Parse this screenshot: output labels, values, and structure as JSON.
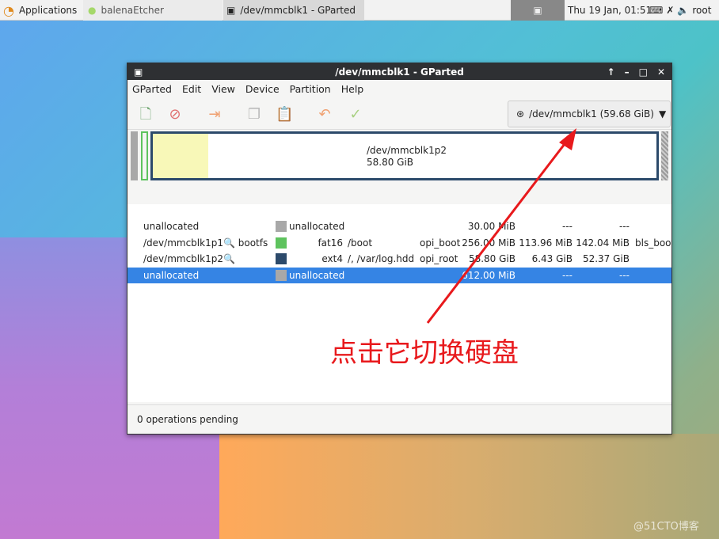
{
  "taskbar": {
    "applications": "Applications",
    "tasks": [
      {
        "label": "balenaEtcher"
      },
      {
        "label": "/dev/mmcblk1 - GParted"
      }
    ],
    "clock": "Thu 19 Jan, 01:51",
    "user": "root"
  },
  "window": {
    "title": "/dev/mmcblk1 - GParted",
    "menu": [
      "GParted",
      "Edit",
      "View",
      "Device",
      "Partition",
      "Help"
    ],
    "device_selector": "/dev/mmcblk1 (59.68 GiB)",
    "diskmap": {
      "partition": "/dev/mmcblk1p2",
      "size": "58.80 GiB",
      "used_fraction": 0.11
    },
    "rows": [
      {
        "partition": "unallocated",
        "name": "",
        "color": "#a8a8a8",
        "filesystem": "unallocated",
        "mount": "",
        "label": "",
        "size": "30.00 MiB",
        "used": "---",
        "unused": "---",
        "flags": ""
      },
      {
        "partition": "/dev/mmcblk1p1",
        "name": "bootfs",
        "color": "#5ec35e",
        "filesystem": "fat16",
        "mount": "/boot",
        "label": "opi_boot",
        "size": "256.00 MiB",
        "used": "113.96 MiB",
        "unused": "142.04 MiB",
        "flags": "bls_boot"
      },
      {
        "partition": "/dev/mmcblk1p2",
        "name": "",
        "color": "#2c4a6b",
        "filesystem": "ext4",
        "mount": "/, /var/log.hdd",
        "label": "opi_root",
        "size": "58.80 GiB",
        "used": "6.43 GiB",
        "unused": "52.37 GiB",
        "flags": ""
      },
      {
        "partition": "unallocated",
        "name": "",
        "color": "#a8a8a8",
        "filesystem": "unallocated",
        "mount": "",
        "label": "",
        "size": "612.00 MiB",
        "used": "---",
        "unused": "---",
        "flags": "",
        "selected": true
      }
    ],
    "status": "0 operations pending"
  },
  "annotation": {
    "text": "点击它切换硬盘",
    "color": "#e8191c"
  },
  "watermark": "@51CTO博客"
}
